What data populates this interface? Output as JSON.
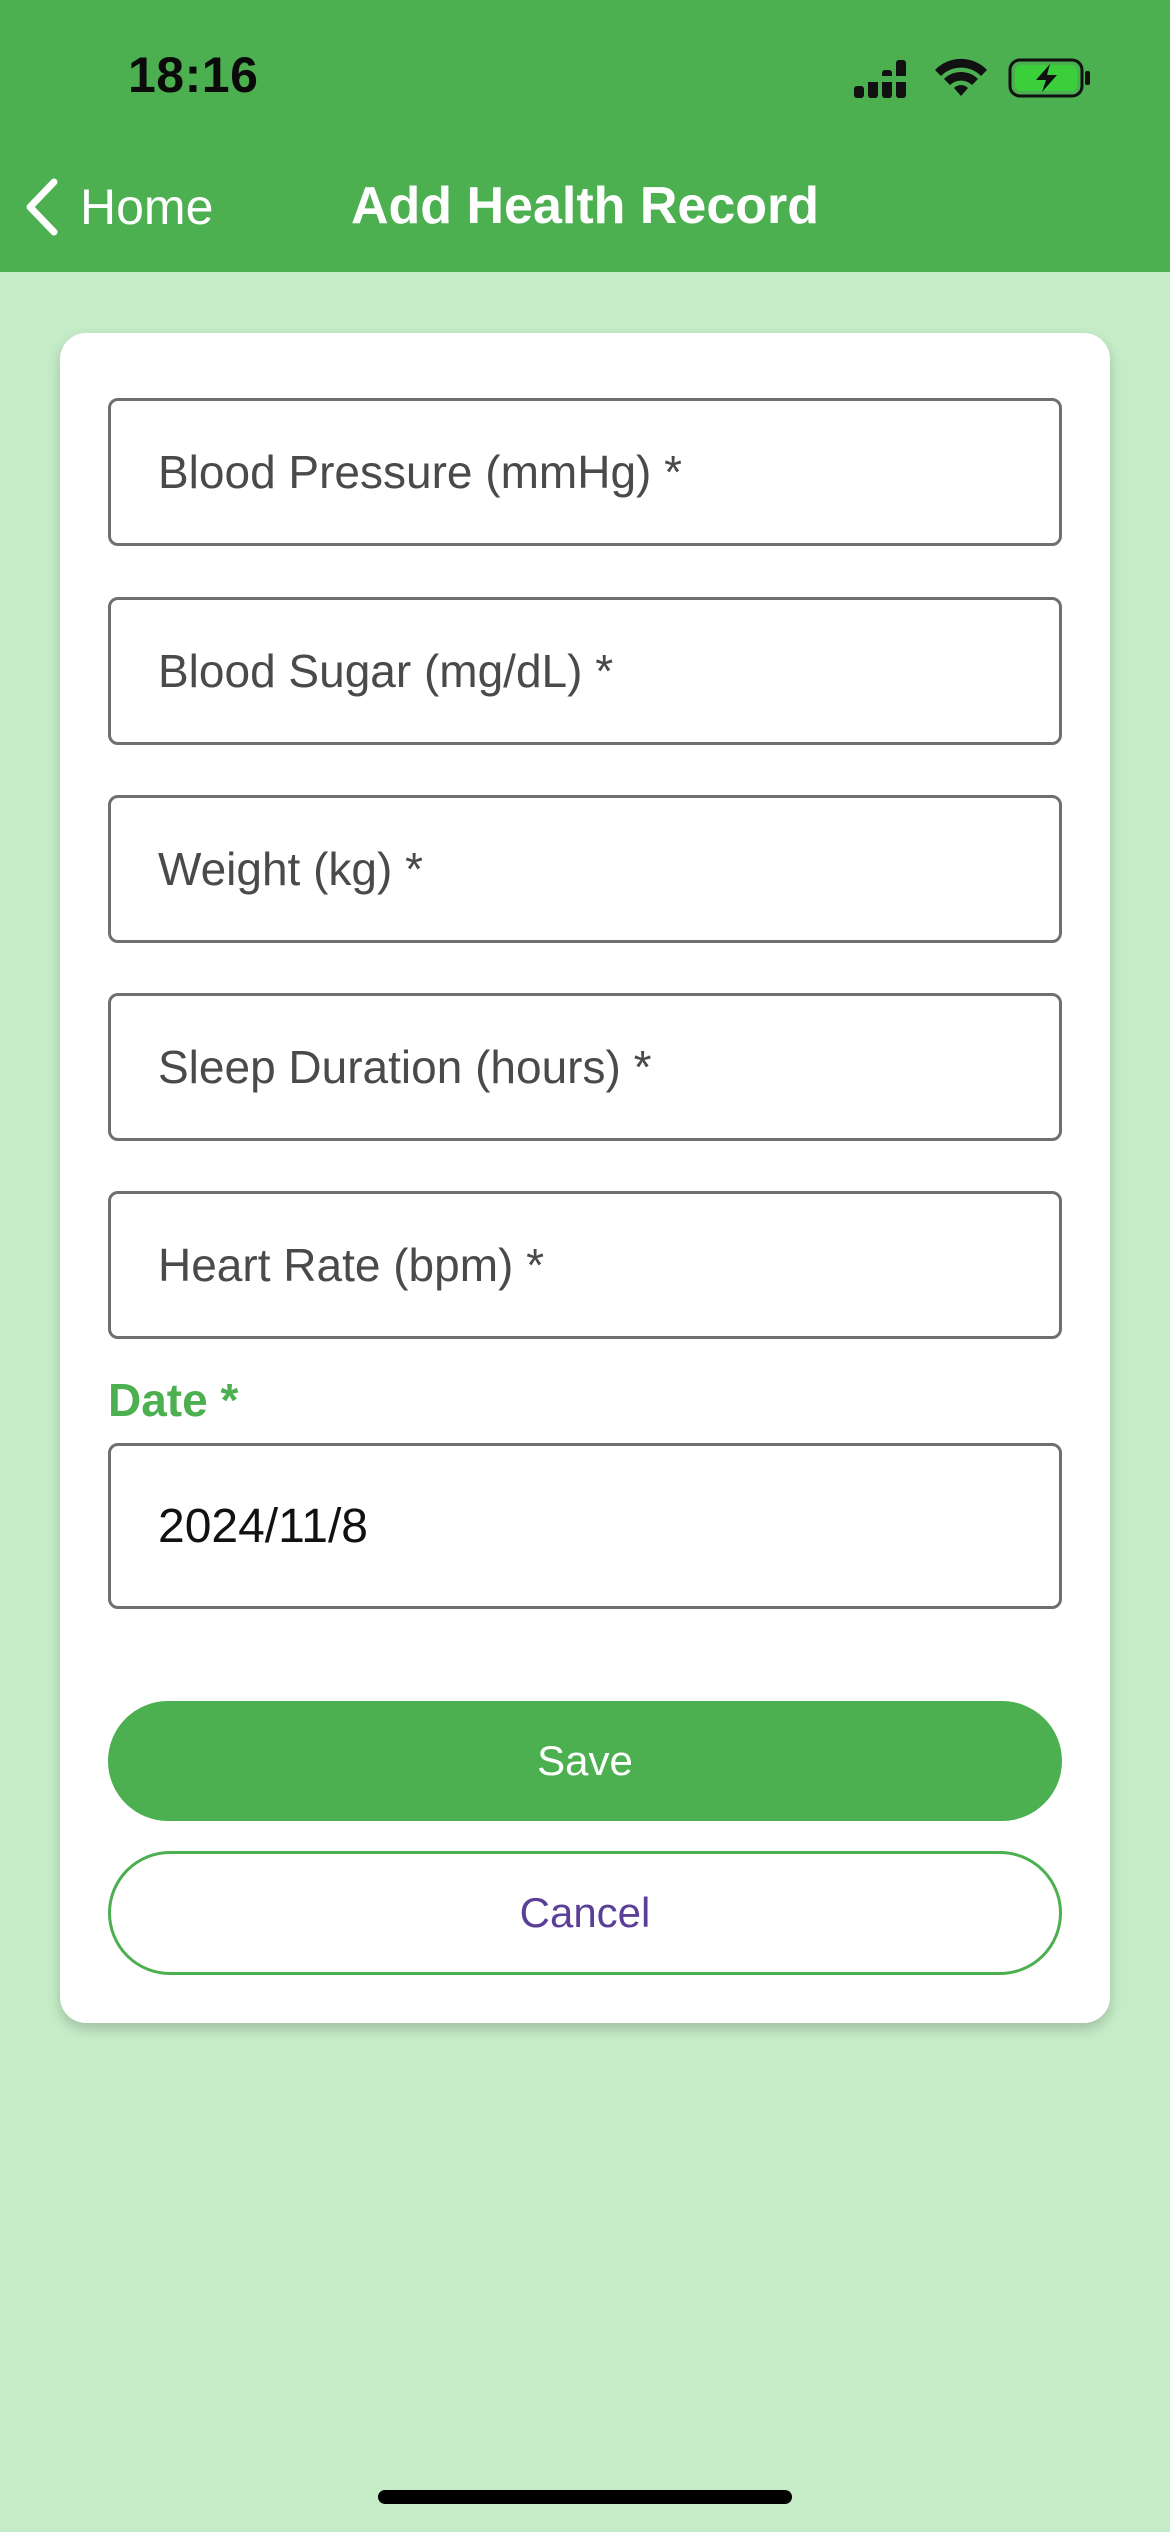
{
  "status_bar": {
    "time": "18:16",
    "icons": [
      "cellular-signal-icon",
      "wifi-icon",
      "battery-charging-icon"
    ]
  },
  "nav": {
    "back_label": "Home",
    "back_icon": "chevron-left-icon",
    "title": "Add Health Record"
  },
  "form": {
    "fields": [
      {
        "placeholder": "Blood Pressure (mmHg) *",
        "value": ""
      },
      {
        "placeholder": "Blood Sugar (mg/dL) *",
        "value": ""
      },
      {
        "placeholder": "Weight (kg) *",
        "value": ""
      },
      {
        "placeholder": "Sleep Duration (hours) *",
        "value": ""
      },
      {
        "placeholder": "Heart Rate (bpm) *",
        "value": ""
      }
    ],
    "date_label": "Date *",
    "date_value": "2024/11/8",
    "save_label": "Save",
    "cancel_label": "Cancel"
  },
  "colors": {
    "primary": "#4caf50",
    "background": "#c5ebc7",
    "card": "#ffffff",
    "cancel_text": "#5b3e96"
  }
}
